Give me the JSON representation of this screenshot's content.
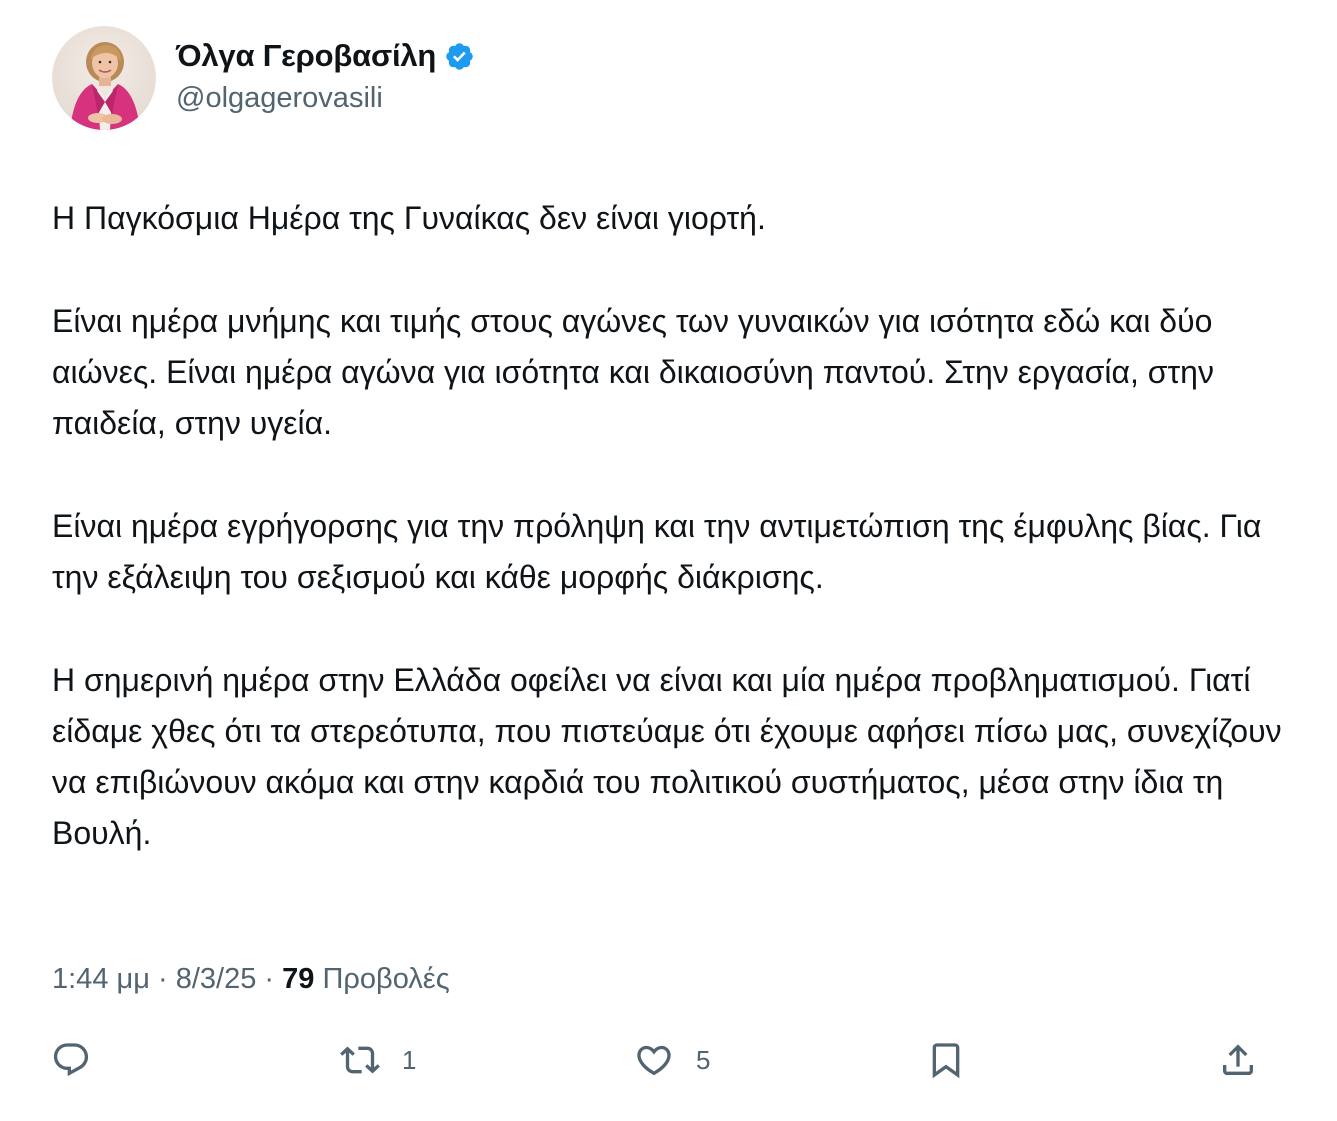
{
  "author": {
    "display_name": "Όλγα Γεροβασίλη",
    "handle": "@olgagerovasili",
    "verified": true,
    "verified_color": "#1d9bf0"
  },
  "tweet": {
    "paragraphs": [
      "Η Παγκόσμια Ημέρα της Γυναίκας δεν είναι γιορτή.",
      "Είναι ημέρα μνήμης και τιμής στους αγώνες των γυναικών για ισότητα εδώ και δύο αιώνες. Είναι ημέρα αγώνα για ισότητα και δικαιοσύνη παντού. Στην εργασία, στην παιδεία, στην υγεία.",
      "Είναι ημέρα εγρήγορσης για την πρόληψη και την αντιμετώπιση της έμφυλης βίας. Για την εξάλειψη του σεξισμού και κάθε μορφής διάκρισης.",
      "Η σημερινή ημέρα στην Ελλάδα οφείλει να είναι και μία ημέρα προβληματισμού. Γιατί είδαμε χθες ότι τα στερεότυπα, που πιστεύαμε ότι έχουμε αφήσει πίσω μας, συνεχίζουν να επιβιώνουν ακόμα και στην καρδιά του πολιτικού συστήματος, μέσα στην ίδια τη Βουλή."
    ]
  },
  "meta": {
    "time": "1:44 μμ",
    "separator": " · ",
    "date": "8/3/25",
    "views_count": "79",
    "views_label": " Προβολές"
  },
  "actions": {
    "reply_count": "",
    "retweet_count": "1",
    "like_count": "5"
  },
  "colors": {
    "text": "#0f1419",
    "secondary": "#536471",
    "icon": "#536471"
  },
  "icons": {
    "reply": "reply-icon",
    "retweet": "retweet-icon",
    "like": "heart-icon",
    "bookmark": "bookmark-icon",
    "share": "share-icon",
    "verified": "verified-badge-icon"
  }
}
